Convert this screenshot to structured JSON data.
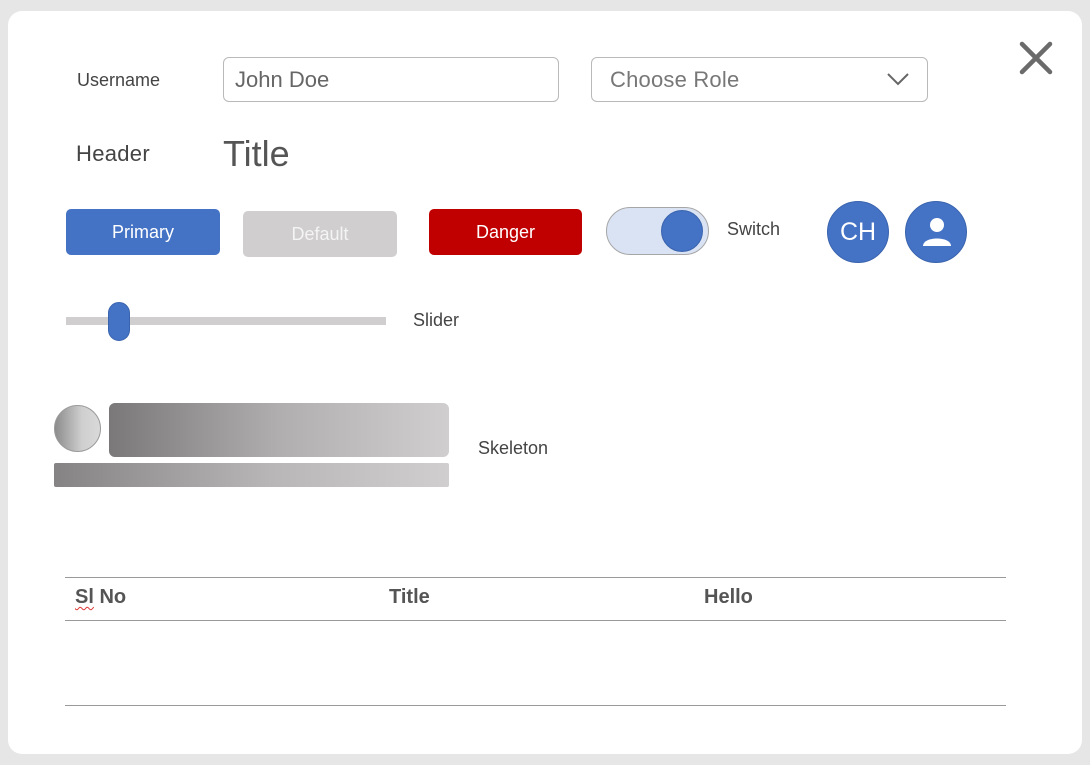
{
  "form": {
    "username_label": "Username",
    "username_value": "John Doe",
    "role_select": {
      "selected": "Choose Role"
    }
  },
  "header": {
    "label": "Header",
    "title": "Title"
  },
  "buttons": {
    "primary": "Primary",
    "default": "Default",
    "danger": "Danger"
  },
  "switch": {
    "label": "Switch",
    "on": true
  },
  "avatars": {
    "initials": "CH",
    "second_icon": "user-icon"
  },
  "slider": {
    "label": "Slider",
    "value_fraction": 0.16
  },
  "skeleton": {
    "label": "Skeleton"
  },
  "table": {
    "columns": [
      "Sl No",
      "Title",
      "Hello"
    ],
    "rows": []
  },
  "colors": {
    "primary": "#4472c4",
    "default": "#d0cece",
    "danger": "#c00000",
    "switch_track": "#dae3f3"
  },
  "icons": {
    "close": "close-icon",
    "dropdown": "chevron-down-icon",
    "user": "user-icon"
  }
}
